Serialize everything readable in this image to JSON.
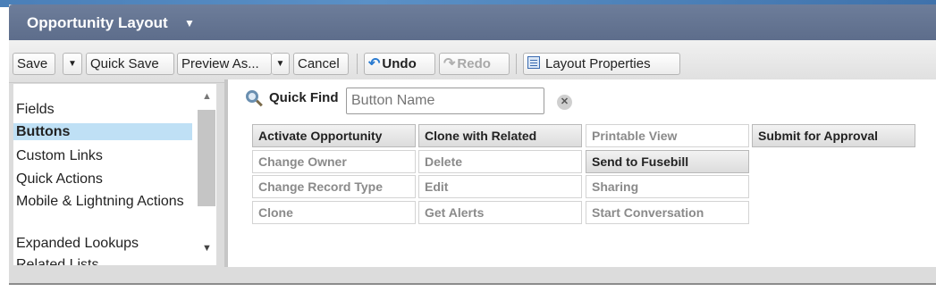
{
  "header": {
    "title": "Opportunity Layout"
  },
  "toolbar": {
    "save": "Save",
    "quick_save": "Quick Save",
    "preview_as": "Preview As...",
    "cancel": "Cancel",
    "undo": "Undo",
    "redo": "Redo",
    "layout_properties": "Layout Properties"
  },
  "sidebar": {
    "items": [
      {
        "label": "Fields"
      },
      {
        "label": "Buttons"
      },
      {
        "label": "Custom Links"
      },
      {
        "label": "Quick Actions"
      },
      {
        "label": "Mobile & Lightning Actions"
      },
      {
        "label": "Expanded Lookups"
      },
      {
        "label": "Related Lists"
      }
    ],
    "active_item": "Buttons"
  },
  "quick_find": {
    "label": "Quick Find",
    "placeholder": "Button Name"
  },
  "buttons_grid": {
    "columns": [
      [
        "Activate Opportunity",
        "Change Owner",
        "Change Record Type",
        "Clone"
      ],
      [
        "Clone with Related",
        "Delete",
        "Edit",
        "Get Alerts"
      ],
      [
        "Printable View",
        "Send to Fusebill",
        "Sharing",
        "Start Conversation"
      ],
      [
        "Submit for Approval"
      ]
    ]
  },
  "colors": {
    "header_bg": "#5d6d8b",
    "active_item_bg": "#bfe0f5",
    "undo_icon": "#2a7bd0"
  }
}
